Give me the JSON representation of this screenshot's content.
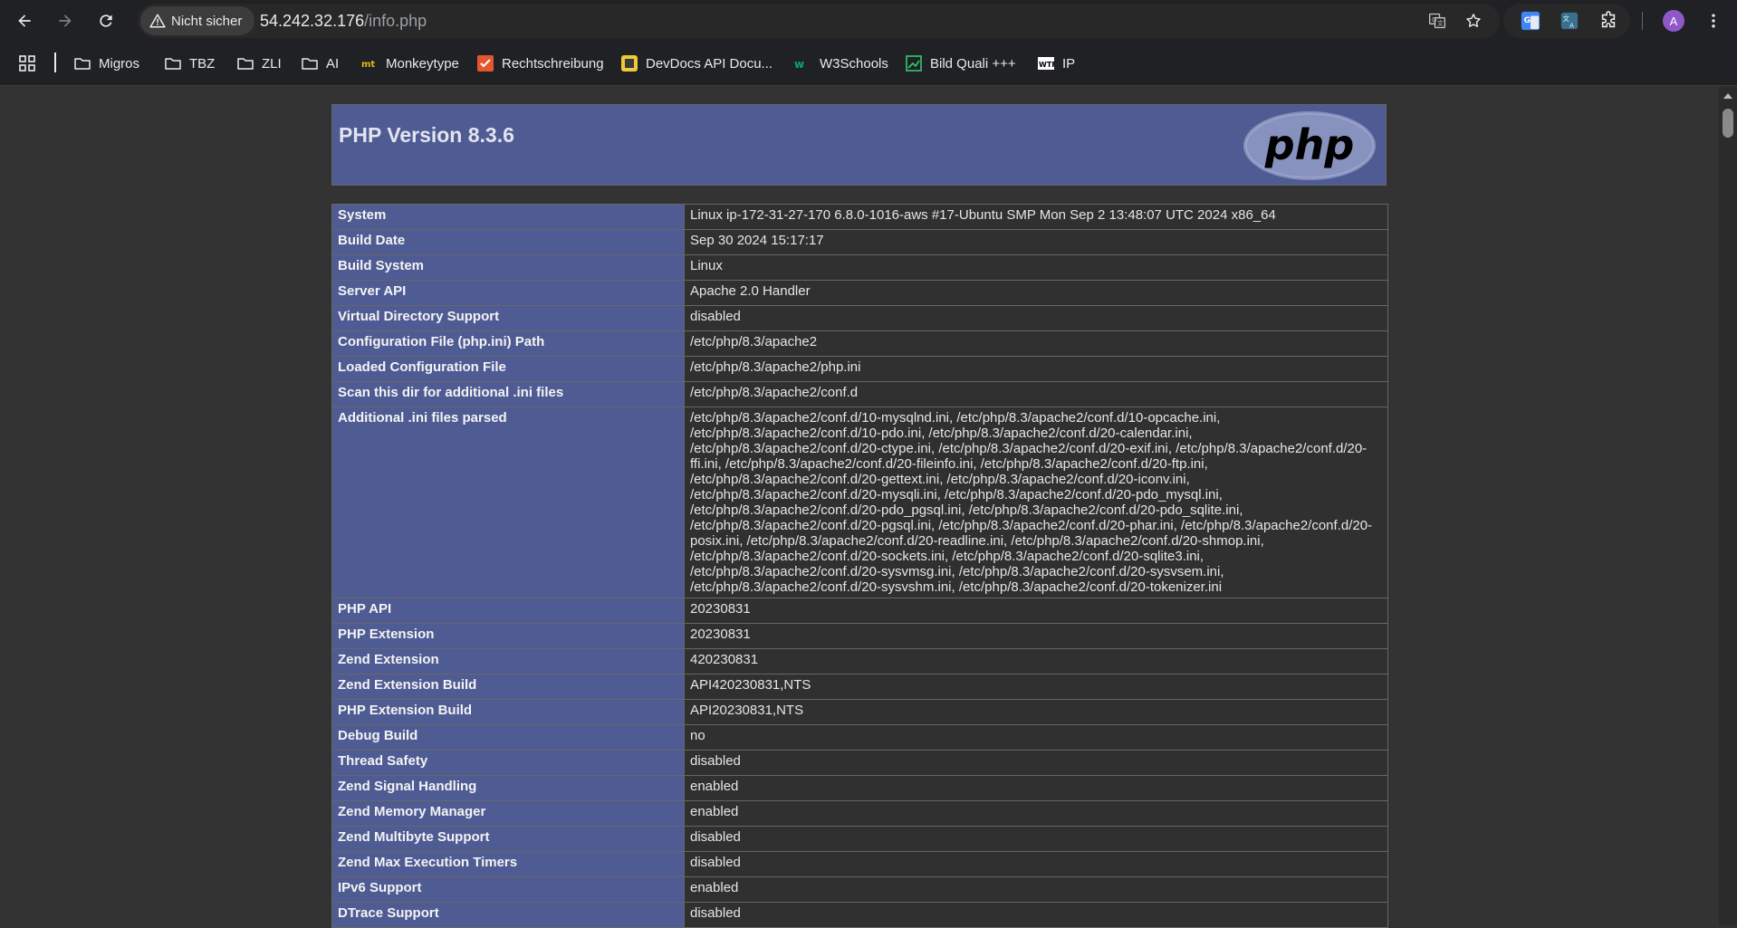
{
  "browser": {
    "security_label": "Nicht sicher",
    "url_host": "54.242.32.176",
    "url_path": "/info.php",
    "profile_initial": "A"
  },
  "bookmarks": [
    {
      "label": "Migros",
      "icon": "folder-icon"
    },
    {
      "label": "TBZ",
      "icon": "folder-icon"
    },
    {
      "label": "ZLI",
      "icon": "folder-icon"
    },
    {
      "label": "AI",
      "icon": "folder-icon"
    },
    {
      "label": "Monkeytype",
      "icon": "monkeytype-icon"
    },
    {
      "label": "Rechtschreibung",
      "icon": "rechtschreibung-icon"
    },
    {
      "label": "DevDocs API Docu...",
      "icon": "devdocs-icon"
    },
    {
      "label": "W3Schools",
      "icon": "w3schools-icon"
    },
    {
      "label": "Bild Quali +++",
      "icon": "bild-quali-icon"
    },
    {
      "label": "IP",
      "icon": "wtf-icon"
    }
  ],
  "page": {
    "title": "PHP Version 8.3.6",
    "logo_text": "php",
    "rows": [
      {
        "key": "System",
        "value": "Linux ip-172-31-27-170 6.8.0-1016-aws #17-Ubuntu SMP Mon Sep 2 13:48:07 UTC 2024 x86_64"
      },
      {
        "key": "Build Date",
        "value": "Sep 30 2024 15:17:17"
      },
      {
        "key": "Build System",
        "value": "Linux"
      },
      {
        "key": "Server API",
        "value": "Apache 2.0 Handler"
      },
      {
        "key": "Virtual Directory Support",
        "value": "disabled"
      },
      {
        "key": "Configuration File (php.ini) Path",
        "value": "/etc/php/8.3/apache2"
      },
      {
        "key": "Loaded Configuration File",
        "value": "/etc/php/8.3/apache2/php.ini"
      },
      {
        "key": "Scan this dir for additional .ini files",
        "value": "/etc/php/8.3/apache2/conf.d"
      },
      {
        "key": "Additional .ini files parsed",
        "value": "/etc/php/8.3/apache2/conf.d/10-mysqlnd.ini, /etc/php/8.3/apache2/conf.d/10-opcache.ini, /etc/php/8.3/apache2/conf.d/10-pdo.ini, /etc/php/8.3/apache2/conf.d/20-calendar.ini, /etc/php/8.3/apache2/conf.d/20-ctype.ini, /etc/php/8.3/apache2/conf.d/20-exif.ini, /etc/php/8.3/apache2/conf.d/20-ffi.ini, /etc/php/8.3/apache2/conf.d/20-fileinfo.ini, /etc/php/8.3/apache2/conf.d/20-ftp.ini, /etc/php/8.3/apache2/conf.d/20-gettext.ini, /etc/php/8.3/apache2/conf.d/20-iconv.ini, /etc/php/8.3/apache2/conf.d/20-mysqli.ini, /etc/php/8.3/apache2/conf.d/20-pdo_mysql.ini, /etc/php/8.3/apache2/conf.d/20-pdo_pgsql.ini, /etc/php/8.3/apache2/conf.d/20-pdo_sqlite.ini, /etc/php/8.3/apache2/conf.d/20-pgsql.ini, /etc/php/8.3/apache2/conf.d/20-phar.ini, /etc/php/8.3/apache2/conf.d/20-posix.ini, /etc/php/8.3/apache2/conf.d/20-readline.ini, /etc/php/8.3/apache2/conf.d/20-shmop.ini, /etc/php/8.3/apache2/conf.d/20-sockets.ini, /etc/php/8.3/apache2/conf.d/20-sqlite3.ini, /etc/php/8.3/apache2/conf.d/20-sysvmsg.ini, /etc/php/8.3/apache2/conf.d/20-sysvsem.ini, /etc/php/8.3/apache2/conf.d/20-sysvshm.ini, /etc/php/8.3/apache2/conf.d/20-tokenizer.ini"
      },
      {
        "key": "PHP API",
        "value": "20230831"
      },
      {
        "key": "PHP Extension",
        "value": "20230831"
      },
      {
        "key": "Zend Extension",
        "value": "420230831"
      },
      {
        "key": "Zend Extension Build",
        "value": "API420230831,NTS"
      },
      {
        "key": "PHP Extension Build",
        "value": "API20230831,NTS"
      },
      {
        "key": "Debug Build",
        "value": "no"
      },
      {
        "key": "Thread Safety",
        "value": "disabled"
      },
      {
        "key": "Zend Signal Handling",
        "value": "enabled"
      },
      {
        "key": "Zend Memory Manager",
        "value": "enabled"
      },
      {
        "key": "Zend Multibyte Support",
        "value": "disabled"
      },
      {
        "key": "Zend Max Execution Timers",
        "value": "disabled"
      },
      {
        "key": "IPv6 Support",
        "value": "enabled"
      },
      {
        "key": "DTrace Support",
        "value": "disabled"
      }
    ]
  },
  "colors": {
    "header_bg": "#4f5b93",
    "key_cell_bg": "#4f5b93",
    "value_cell_bg": "#303030",
    "page_bg": "#333333"
  }
}
